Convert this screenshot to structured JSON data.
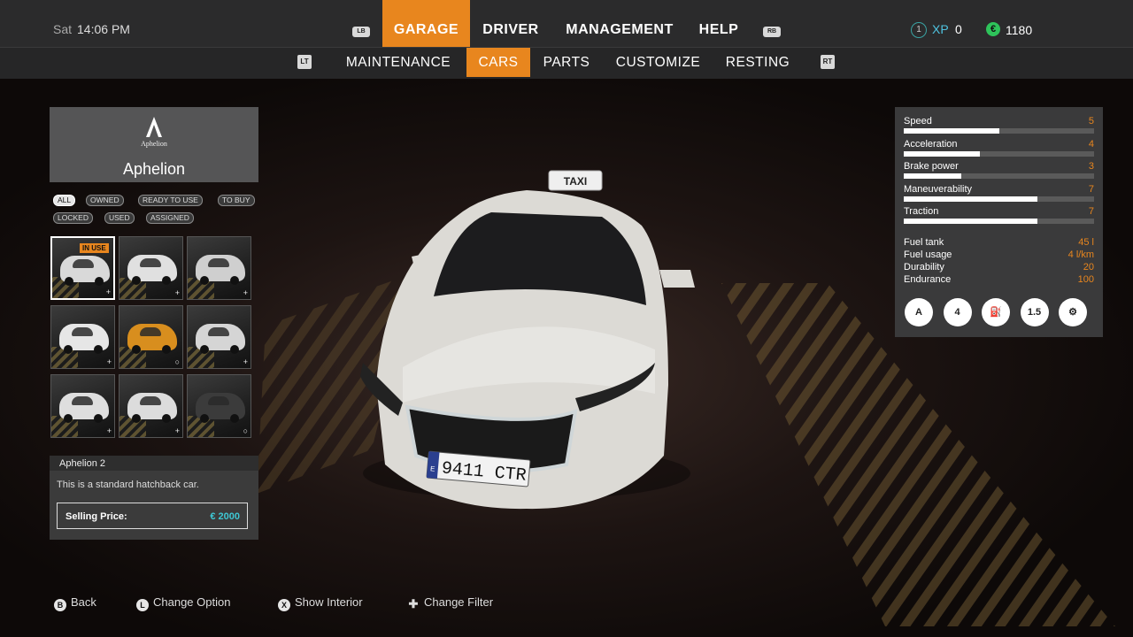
{
  "clock": {
    "day": "Sat",
    "time": "14:06 PM"
  },
  "nav": {
    "lb": "LB",
    "rb": "RB",
    "tabs": [
      "GARAGE",
      "DRIVER",
      "MANAGEMENT",
      "HELP"
    ]
  },
  "subnav": {
    "lt": "LT",
    "rt": "RT",
    "tabs": [
      "MAINTENANCE",
      "CARS",
      "PARTS",
      "CUSTOMIZE",
      "RESTING"
    ]
  },
  "status": {
    "level": "1",
    "xp_label": "XP",
    "xp_value": "0",
    "currency_icon": "€",
    "money": "1180"
  },
  "brand": {
    "logo_text": "Aphelion",
    "name": "Aphelion"
  },
  "filters": [
    "ALL",
    "OWNED",
    "READY TO USE",
    "TO BUY",
    "LOCKED",
    "USED",
    "ASSIGNED"
  ],
  "cars": [
    {
      "color": "#d9d9d9",
      "badge": "IN USE",
      "mark": "+"
    },
    {
      "color": "#e0e0e0",
      "badge": "",
      "mark": "+"
    },
    {
      "color": "#cfcfcf",
      "badge": "",
      "mark": "+"
    },
    {
      "color": "#e6e6e6",
      "badge": "",
      "mark": "+"
    },
    {
      "color": "#d88e1e",
      "badge": "",
      "mark": "○"
    },
    {
      "color": "#d5d5d5",
      "badge": "",
      "mark": "+"
    },
    {
      "color": "#dedede",
      "badge": "",
      "mark": "+"
    },
    {
      "color": "#dcdcdc",
      "badge": "",
      "mark": "+"
    },
    {
      "color": "#3b3b3b",
      "badge": "",
      "mark": "○"
    }
  ],
  "info": {
    "name": "Aphelion  2",
    "description": "This is a standard hatchback car.",
    "price_label": "Selling Price:",
    "price_value": "€  2000"
  },
  "stats": [
    {
      "name": "Speed",
      "value": "5",
      "fraction": 0.5
    },
    {
      "name": "Acceleration",
      "value": "4",
      "fraction": 0.4
    },
    {
      "name": "Brake power",
      "value": "3",
      "fraction": 0.3
    },
    {
      "name": "Maneuverability",
      "value": "7",
      "fraction": 0.7
    },
    {
      "name": "Traction",
      "value": "7",
      "fraction": 0.7
    }
  ],
  "specs": [
    {
      "name": "Fuel tank",
      "value": "45 l"
    },
    {
      "name": "Fuel usage",
      "value": "4 l/km"
    },
    {
      "name": "Durability",
      "value": "20"
    },
    {
      "name": "Endurance",
      "value": "100"
    }
  ],
  "features": [
    {
      "icon": "automatic-transmission-icon",
      "glyph": "A"
    },
    {
      "icon": "four-seats-icon",
      "glyph": "4"
    },
    {
      "icon": "fuel-type-icon",
      "glyph": "⛽"
    },
    {
      "icon": "engine-size-icon",
      "glyph": "1.5"
    },
    {
      "icon": "engine-icon",
      "glyph": "⚙"
    }
  ],
  "car": {
    "taxi_sign": "TAXI",
    "plate": "9411 CTR",
    "plate_country": "E"
  },
  "hints": [
    {
      "button": "B",
      "label": "Back"
    },
    {
      "button": "L",
      "label": "Change Option"
    },
    {
      "button": "X",
      "label": "Show Interior"
    },
    {
      "button": "✚",
      "label": "Change Filter"
    }
  ]
}
